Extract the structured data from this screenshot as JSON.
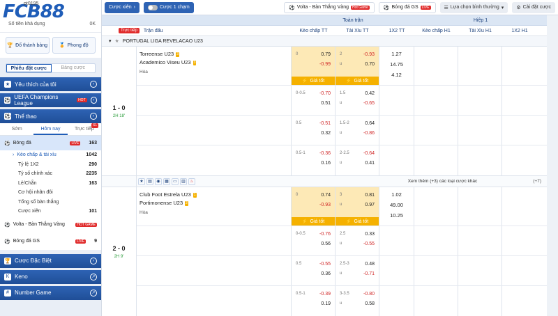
{
  "brand": {
    "logo": "FCB88"
  },
  "account": {
    "id": "pt0195",
    "balance_label": "Số tiền khả dụng",
    "balance_value": "0K"
  },
  "sidebar": {
    "btn_leaderboard": "Đổ thành bảng",
    "btn_phongdo": "Phong độ",
    "bet_tabs": [
      "Phiếu đặt cược",
      "Bảng cược"
    ],
    "sections_top": [
      {
        "label": "Yêu thích của tôi"
      },
      {
        "label": "UEFA Champions League",
        "badge": "HOT"
      },
      {
        "label": "Thể thao"
      }
    ],
    "sport_tabs": [
      {
        "label": "Sớm"
      },
      {
        "label": "Hôm nay"
      },
      {
        "label": "Trực tiếp",
        "badge": "61"
      }
    ],
    "sport": {
      "label": "Bóng đá",
      "badge": "LIVE",
      "count": "163"
    },
    "subs": [
      {
        "label": "Kèo chấp & tài xỉu",
        "count": "1042"
      },
      {
        "label": "Tỷ lệ 1X2",
        "count": "290"
      },
      {
        "label": "Tỷ số chính xác",
        "count": "2235"
      },
      {
        "label": "Lẻ/Chẵn",
        "count": "163"
      },
      {
        "label": "Cơ hội nhân đôi",
        "count": ""
      },
      {
        "label": "Tổng số bàn thắng",
        "count": ""
      },
      {
        "label": "Cược xiên",
        "count": "101"
      }
    ],
    "volta": {
      "label": "Volta - Bàn Thắng Vàng",
      "badge": "HOT GAME"
    },
    "gs": {
      "label": "Bóng đá GS",
      "badge": "LIVE",
      "count": "9"
    },
    "sections_bottom": [
      {
        "label": "Cược Đặc Biệt"
      },
      {
        "label": "Keno"
      },
      {
        "label": "Number Game"
      }
    ]
  },
  "topbar": {
    "parlay": "Cược xiên",
    "onetap": "Cược 1 chạm",
    "volta": "Volta - Bàn Thắng Vàng",
    "volta_badge": "Hot Game",
    "gs": "Bóng đá GS",
    "gs_badge": "LIVE",
    "sort": "Lựa chọn bình thường",
    "settings": "Cài đặt cược"
  },
  "table": {
    "live_tag": "Trực tiếp",
    "match_col": "Trận đấu",
    "fulltime": "Toàn trận",
    "half1": "Hiệp 1",
    "cols": [
      "Kèo chấp TT",
      "Tài Xỉu TT",
      "1X2 TT",
      "Kèo chấp H1",
      "Tài Xỉu H1",
      "1X2 H1"
    ],
    "league": "PORTUGAL LIGA REVELACAO U23",
    "hot_label": "Giá tốt",
    "more_label": "Xem thêm (+3) các loại cược khác",
    "more_count": "(+7)"
  },
  "matches": [
    {
      "score": "1 - 0",
      "time": "2H 18'",
      "home": "Torreense U23",
      "home_n": "3",
      "away": "Academico Viseu U23",
      "away_n": "3",
      "draw": "Hòa",
      "x12": [
        "1.27",
        "14.75",
        "4.12"
      ],
      "rows": [
        {
          "ah": [
            [
              "0",
              "0.79"
            ],
            [
              "",
              "-0.99"
            ]
          ],
          "ou": [
            [
              "2",
              "-0.93"
            ],
            [
              "u",
              "0.70"
            ]
          ]
        },
        {
          "ah": [
            [
              "0-0.5",
              "-0.70"
            ],
            [
              "",
              "0.51"
            ]
          ],
          "ou": [
            [
              "1.5",
              "0.42"
            ],
            [
              "u",
              "-0.65"
            ]
          ]
        },
        {
          "ah": [
            [
              "0.5",
              "-0.51"
            ],
            [
              "",
              "0.32"
            ]
          ],
          "ou": [
            [
              "1.5-2",
              "0.64"
            ],
            [
              "u",
              "-0.86"
            ]
          ]
        },
        {
          "ah": [
            [
              "0.5-1",
              "-0.36"
            ],
            [
              "",
              "0.16"
            ]
          ],
          "ou": [
            [
              "2-2.5",
              "-0.64"
            ],
            [
              "u",
              "0.41"
            ]
          ]
        }
      ]
    },
    {
      "score": "2 - 0",
      "time": "2H 9'",
      "home": "Club Foot Estrela U23",
      "home_n": "1",
      "away": "Portimonense U23",
      "away_n": "2",
      "draw": "Hòa",
      "x12": [
        "1.02",
        "49.00",
        "10.25"
      ],
      "rows": [
        {
          "ah": [
            [
              "0",
              "0.74"
            ],
            [
              "",
              "-0.93"
            ]
          ],
          "ou": [
            [
              "3",
              "0.81"
            ],
            [
              "u",
              "0.97"
            ]
          ]
        },
        {
          "ah": [
            [
              "0-0.5",
              "-0.76"
            ],
            [
              "",
              "0.56"
            ]
          ],
          "ou": [
            [
              "2.5",
              "0.33"
            ],
            [
              "u",
              "-0.55"
            ]
          ]
        },
        {
          "ah": [
            [
              "0.5",
              "-0.55"
            ],
            [
              "",
              "0.36"
            ]
          ],
          "ou": [
            [
              "2.5-3",
              "0.48"
            ],
            [
              "u",
              "-0.71"
            ]
          ]
        },
        {
          "ah": [
            [
              "0.5-1",
              "-0.39"
            ],
            [
              "",
              "0.19"
            ]
          ],
          "ou": [
            [
              "3-3.5",
              "-0.80"
            ],
            [
              "u",
              "0.58"
            ]
          ]
        }
      ]
    }
  ]
}
